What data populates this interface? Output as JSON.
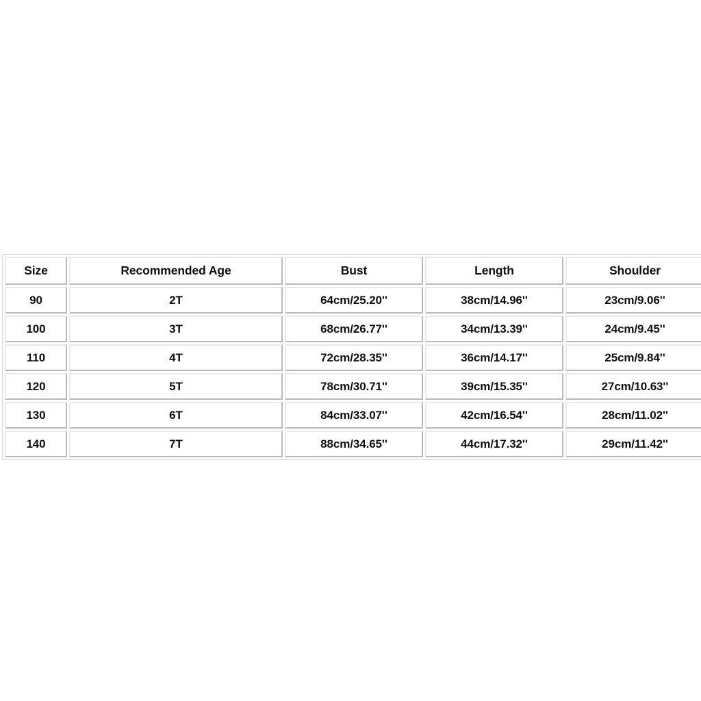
{
  "table": {
    "name": "size-chart",
    "columns": [
      {
        "key": "size",
        "label": "Size"
      },
      {
        "key": "age",
        "label": "Recommended Age"
      },
      {
        "key": "bust",
        "label": "Bust"
      },
      {
        "key": "length",
        "label": "Length"
      },
      {
        "key": "shoulder",
        "label": "Shoulder"
      }
    ],
    "rows": [
      {
        "size": "90",
        "age": "2T",
        "bust": "64cm/25.20''",
        "length": "38cm/14.96''",
        "shoulder": "23cm/9.06''"
      },
      {
        "size": "100",
        "age": "3T",
        "bust": "68cm/26.77''",
        "length": "34cm/13.39''",
        "shoulder": "24cm/9.45''"
      },
      {
        "size": "110",
        "age": "4T",
        "bust": "72cm/28.35''",
        "length": "36cm/14.17''",
        "shoulder": "25cm/9.84''"
      },
      {
        "size": "120",
        "age": "5T",
        "bust": "78cm/30.71''",
        "length": "39cm/15.35''",
        "shoulder": "27cm/10.63''"
      },
      {
        "size": "130",
        "age": "6T",
        "bust": "84cm/33.07''",
        "length": "42cm/16.54''",
        "shoulder": "28cm/11.02''"
      },
      {
        "size": "140",
        "age": "7T",
        "bust": "88cm/34.65''",
        "length": "44cm/17.32''",
        "shoulder": "29cm/11.42''"
      }
    ]
  },
  "colors": {
    "page_background": "#ffffff",
    "cell_background": "#ffffff",
    "text": "#101010",
    "border_light": "#e9e9e9",
    "border_dark": "#b9b9b9",
    "table_frame": "#d6d6d6"
  }
}
